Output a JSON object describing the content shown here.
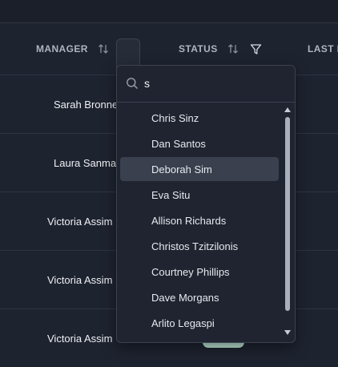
{
  "table": {
    "columns": [
      {
        "label": "MANAGER"
      },
      {
        "label": "STATUS"
      },
      {
        "label": "LAST L"
      }
    ],
    "rows": [
      {
        "manager": "Sarah Bronne"
      },
      {
        "manager": "Laura Sanma"
      },
      {
        "manager": "Victoria Assim"
      },
      {
        "manager": "Victoria Assim"
      },
      {
        "manager": "Victoria Assim"
      }
    ]
  },
  "filter_dropdown": {
    "search_value": "s",
    "hovered_item": "Deborah Sim",
    "items": [
      "Chris Sinz",
      "Dan Santos",
      "Deborah Sim",
      "Eva Situ",
      "Allison Richards",
      "Christos Tzitzilonis",
      "Courtney Phillips",
      "Dave Morgans",
      "Arlito Legaspi"
    ]
  },
  "icons": {
    "sort": "sort-arrows-icon",
    "filter": "filter-funnel-icon",
    "search": "search-icon",
    "scroll_up": "triangle-up-icon",
    "scroll_down": "triangle-down-icon"
  },
  "colors": {
    "background": "#1e2330",
    "dropdown_bg": "#1f2430",
    "hover_bg": "#3a404d",
    "status_pill": "#bfe8d6"
  }
}
